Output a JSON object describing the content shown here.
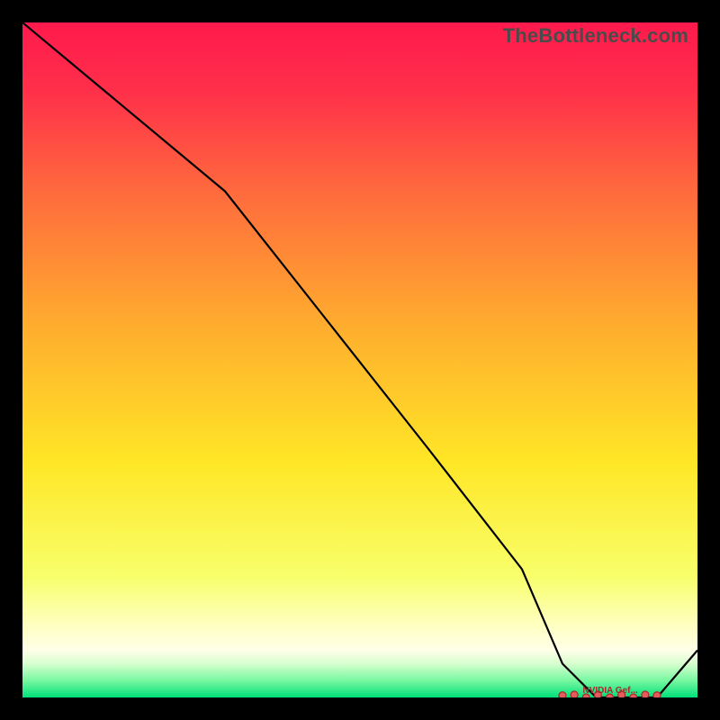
{
  "watermark": "TheBottleneck.com",
  "marker_label": "NVIDIA Gef...",
  "colors": {
    "bg_black": "#000000",
    "line": "#000000",
    "marker_fill": "#e55a5a",
    "marker_stroke": "#a62a2a",
    "watermark": "#4b4b4b"
  },
  "chart_data": {
    "type": "line",
    "title": "",
    "xlabel": "",
    "ylabel": "",
    "x": [
      0.0,
      0.12,
      0.3,
      0.45,
      0.6,
      0.74,
      0.8,
      0.85,
      0.9,
      0.94,
      1.0
    ],
    "y": [
      1.0,
      0.9,
      0.75,
      0.56,
      0.37,
      0.19,
      0.05,
      0.0,
      0.0,
      0.0,
      0.07
    ],
    "ylim": [
      0,
      1
    ],
    "xlim": [
      0,
      1
    ],
    "marker_range_x": [
      0.8,
      0.94
    ],
    "gradient_stops": [
      {
        "offset": 0.0,
        "color": "#ff1a4d"
      },
      {
        "offset": 0.1,
        "color": "#ff2f4a"
      },
      {
        "offset": 0.25,
        "color": "#ff6a3d"
      },
      {
        "offset": 0.45,
        "color": "#ffad2e"
      },
      {
        "offset": 0.65,
        "color": "#ffe626"
      },
      {
        "offset": 0.82,
        "color": "#f8ff6a"
      },
      {
        "offset": 0.89,
        "color": "#ffffbe"
      },
      {
        "offset": 0.93,
        "color": "#ffffe8"
      },
      {
        "offset": 0.95,
        "color": "#d7ffcf"
      },
      {
        "offset": 0.975,
        "color": "#77f7a0"
      },
      {
        "offset": 1.0,
        "color": "#00e07a"
      }
    ]
  }
}
